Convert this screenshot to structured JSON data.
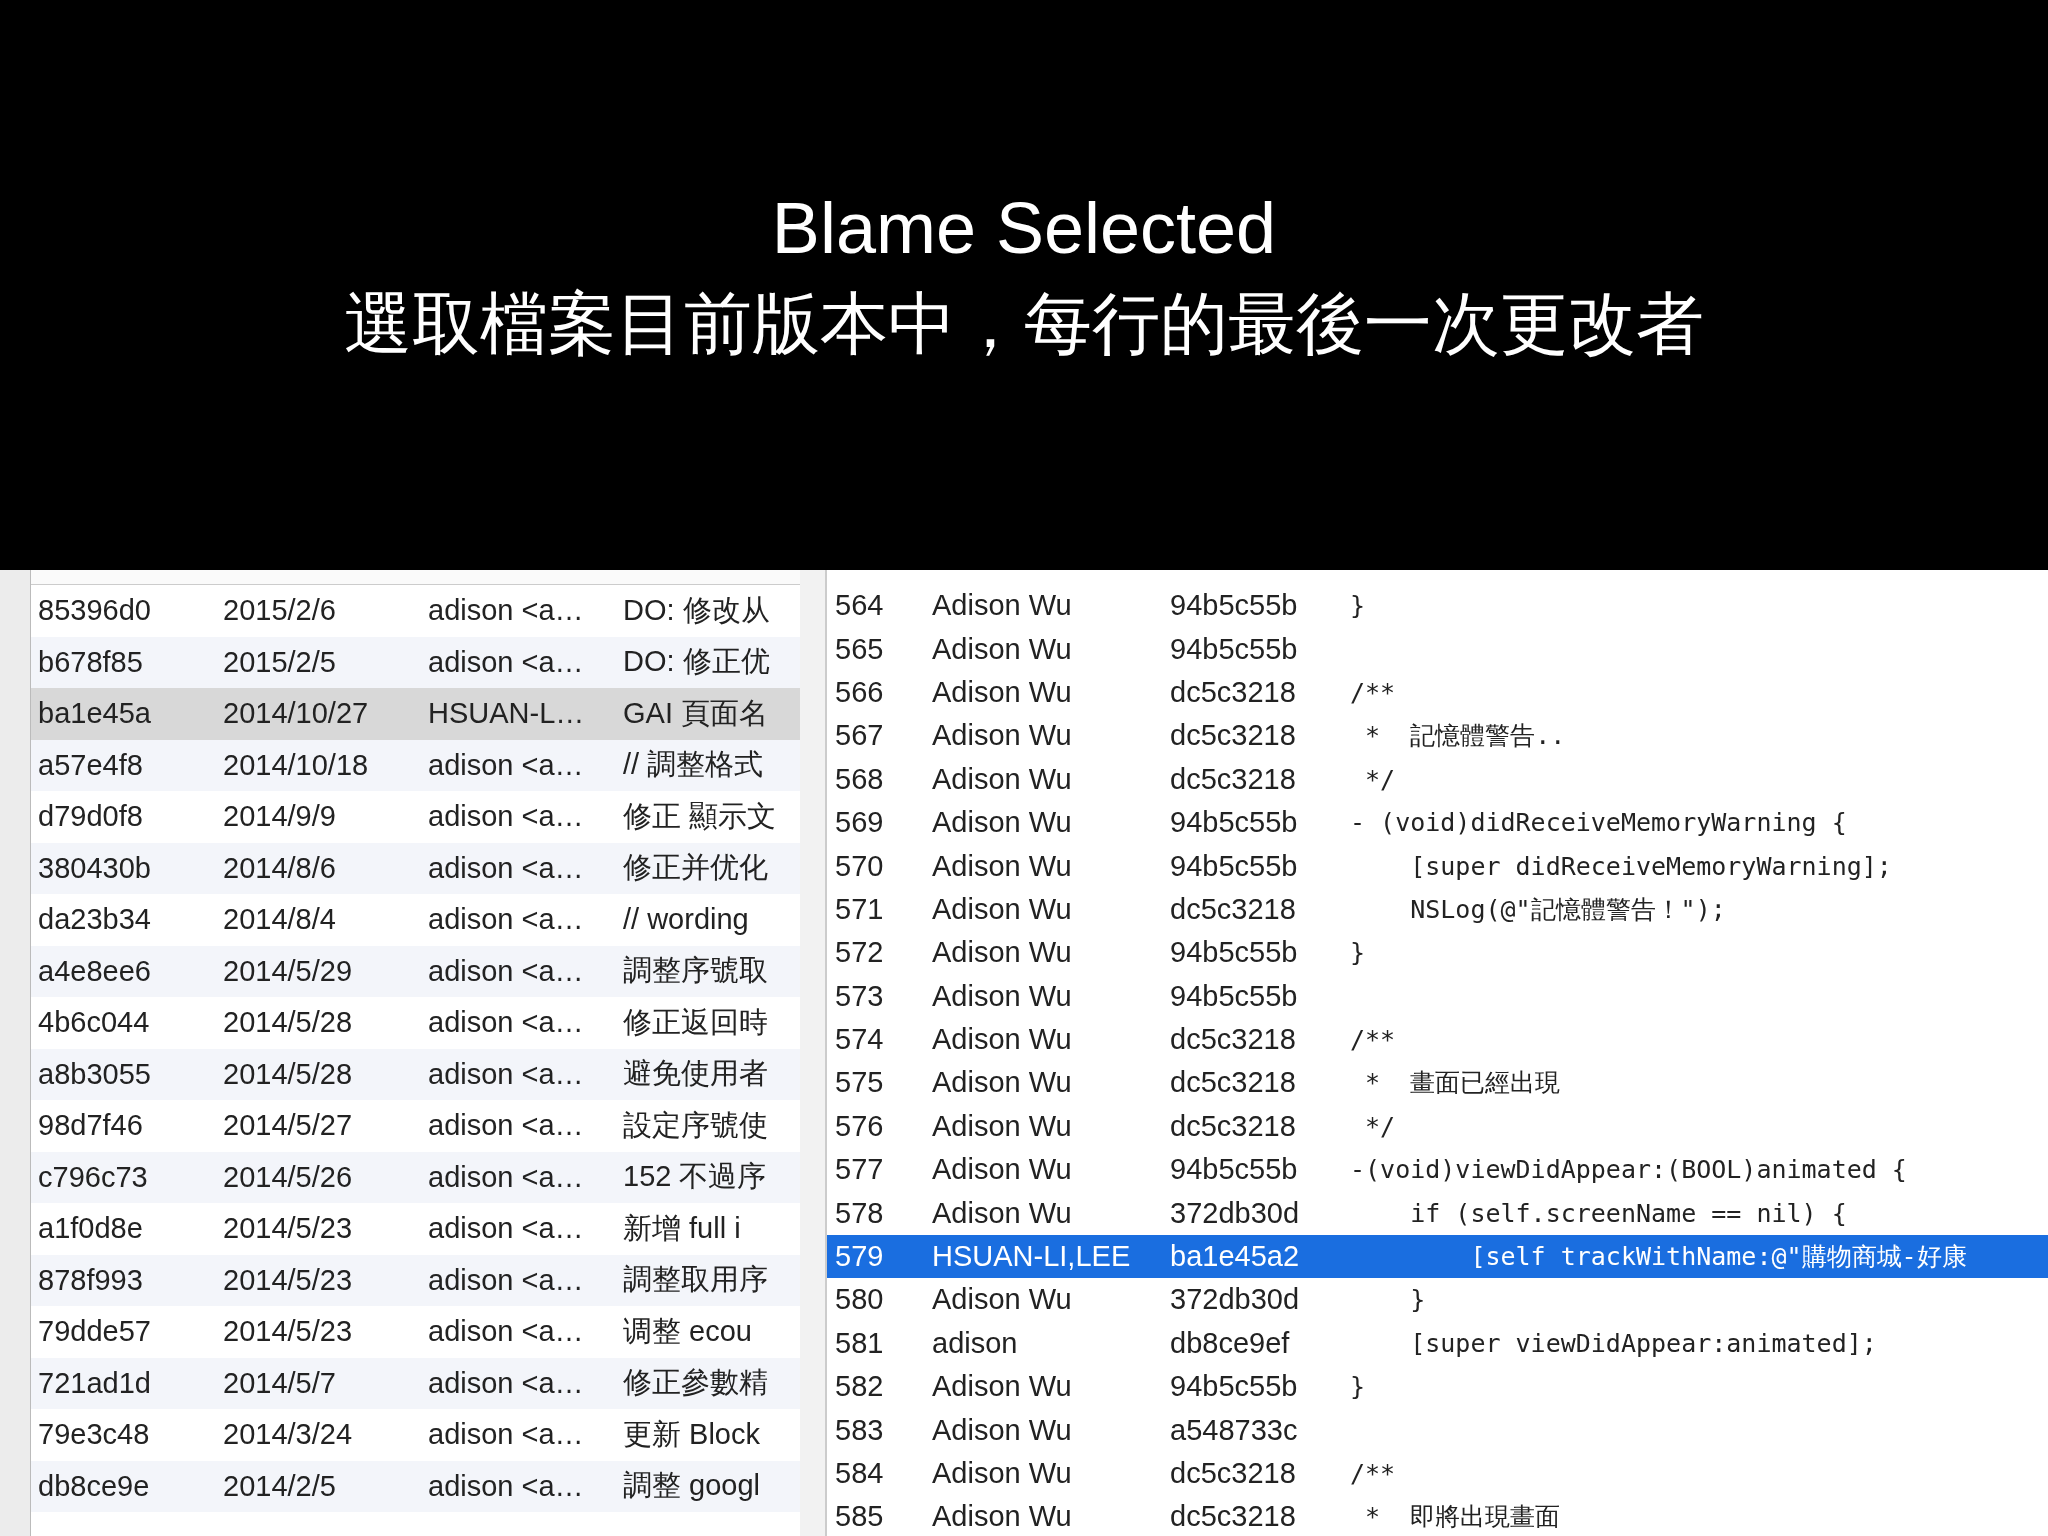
{
  "slide_title": [
    "Blame Selected",
    "選取檔案目前版本中，每行的最後一次更改者"
  ],
  "history_table": {
    "rows": [
      {
        "changeset": "85396d0",
        "date": "2015/2/6",
        "user": "adison <a…",
        "description": "DO: 修改从",
        "selected": false
      },
      {
        "changeset": "b678f85",
        "date": "2015/2/5",
        "user": "adison <a…",
        "description": "DO: 修正优",
        "selected": false
      },
      {
        "changeset": "ba1e45a",
        "date": "2014/10/27",
        "user": "HSUAN-L…",
        "description": "GAI 頁面名",
        "selected": true
      },
      {
        "changeset": "a57e4f8",
        "date": "2014/10/18",
        "user": "adison <a…",
        "description": "// 調整格式",
        "selected": false
      },
      {
        "changeset": "d79d0f8",
        "date": "2014/9/9",
        "user": "adison <a…",
        "description": "修正 顯示文",
        "selected": false
      },
      {
        "changeset": "380430b",
        "date": "2014/8/6",
        "user": "adison <a…",
        "description": "修正并优化",
        "selected": false
      },
      {
        "changeset": "da23b34",
        "date": "2014/8/4",
        "user": "adison <a…",
        "description": "// wording",
        "selected": false
      },
      {
        "changeset": "a4e8ee6",
        "date": "2014/5/29",
        "user": "adison <a…",
        "description": "調整序號取",
        "selected": false
      },
      {
        "changeset": "4b6c044",
        "date": "2014/5/28",
        "user": "adison <a…",
        "description": "修正返回時",
        "selected": false
      },
      {
        "changeset": "a8b3055",
        "date": "2014/5/28",
        "user": "adison <a…",
        "description": "避免使用者",
        "selected": false
      },
      {
        "changeset": "98d7f46",
        "date": "2014/5/27",
        "user": "adison <a…",
        "description": "設定序號使",
        "selected": false
      },
      {
        "changeset": "c796c73",
        "date": "2014/5/26",
        "user": "adison <a…",
        "description": "152 不過序",
        "selected": false
      },
      {
        "changeset": "a1f0d8e",
        "date": "2014/5/23",
        "user": "adison <a…",
        "description": "新增 full i",
        "selected": false
      },
      {
        "changeset": "878f993",
        "date": "2014/5/23",
        "user": "adison <a…",
        "description": "調整取用序",
        "selected": false
      },
      {
        "changeset": "79dde57",
        "date": "2014/5/23",
        "user": "adison <a…",
        "description": "调整 ecou",
        "selected": false
      },
      {
        "changeset": "721ad1d",
        "date": "2014/5/7",
        "user": "adison <a…",
        "description": "修正參數精",
        "selected": false
      },
      {
        "changeset": "79e3c48",
        "date": "2014/3/24",
        "user": "adison <a…",
        "description": "更新 Block",
        "selected": false
      },
      {
        "changeset": "db8ce9e",
        "date": "2014/2/5",
        "user": "adison <a…",
        "description": "調整 googl",
        "selected": false
      }
    ]
  },
  "blame_lines": [
    {
      "line": "564",
      "author": "Adison Wu",
      "revision": "94b5c55b",
      "code": "}",
      "selected": false
    },
    {
      "line": "565",
      "author": "Adison Wu",
      "revision": "94b5c55b",
      "selected": false
    },
    {
      "line": "566",
      "author": "Adison Wu",
      "revision": "dc5c3218",
      "code": "/**",
      "selected": false
    },
    {
      "line": "567",
      "author": "Adison Wu",
      "revision": "dc5c3218",
      "code": " *  記憶體警告..",
      "selected": false
    },
    {
      "line": "568",
      "author": "Adison Wu",
      "revision": "dc5c3218",
      "code": " */",
      "selected": false
    },
    {
      "line": "569",
      "author": "Adison Wu",
      "revision": "94b5c55b",
      "code": "- (void)didReceiveMemoryWarning {",
      "selected": false
    },
    {
      "line": "570",
      "author": "Adison Wu",
      "revision": "94b5c55b",
      "code": "    [super didReceiveMemoryWarning];",
      "selected": false
    },
    {
      "line": "571",
      "author": "Adison Wu",
      "revision": "dc5c3218",
      "code": "    NSLog(@\"記憶體警告！\");",
      "selected": false
    },
    {
      "line": "572",
      "author": "Adison Wu",
      "revision": "94b5c55b",
      "code": "}",
      "selected": false
    },
    {
      "line": "573",
      "author": "Adison Wu",
      "revision": "94b5c55b",
      "selected": false
    },
    {
      "line": "574",
      "author": "Adison Wu",
      "revision": "dc5c3218",
      "code": "/**",
      "selected": false
    },
    {
      "line": "575",
      "author": "Adison Wu",
      "revision": "dc5c3218",
      "code": " *  畫面已經出現",
      "selected": false
    },
    {
      "line": "576",
      "author": "Adison Wu",
      "revision": "dc5c3218",
      "code": " */",
      "selected": false
    },
    {
      "line": "577",
      "author": "Adison Wu",
      "revision": "94b5c55b",
      "code": "-(void)viewDidAppear:(BOOL)animated {",
      "selected": false
    },
    {
      "line": "578",
      "author": "Adison Wu",
      "revision": "372db30d",
      "code": "    if (self.screenName == nil) {",
      "selected": false
    },
    {
      "line": "579",
      "author": "HSUAN-LI,LEE",
      "revision": "ba1e45a2",
      "code": "        [self trackWithName:@\"購物商城-好康",
      "selected": true
    },
    {
      "line": "580",
      "author": "Adison Wu",
      "revision": "372db30d",
      "code": "    }",
      "selected": false
    },
    {
      "line": "581",
      "author": "adison",
      "revision": "db8ce9ef",
      "code": "    [super viewDidAppear:animated];",
      "selected": false
    },
    {
      "line": "582",
      "author": "Adison Wu",
      "revision": "94b5c55b",
      "code": "}",
      "selected": false
    },
    {
      "line": "583",
      "author": "Adison Wu",
      "revision": "a548733c",
      "selected": false
    },
    {
      "line": "584",
      "author": "Adison Wu",
      "revision": "dc5c3218",
      "code": "/**",
      "selected": false
    },
    {
      "line": "585",
      "author": "Adison Wu",
      "revision": "dc5c3218",
      "code": " *  即將出現畫面",
      "selected": false
    }
  ]
}
